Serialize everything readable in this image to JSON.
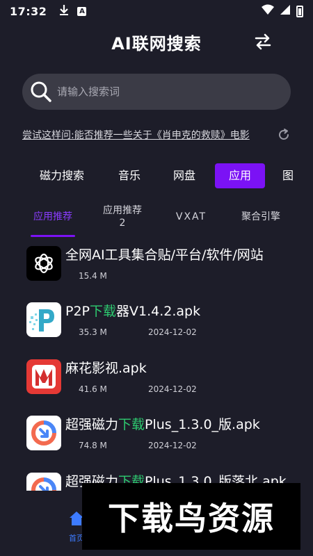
{
  "status_bar": {
    "time": "17:32",
    "icons": [
      "download-icon",
      "a-badge-icon",
      "wifi-icon",
      "signal-icon",
      "battery-icon"
    ]
  },
  "header": {
    "title": "AI联网搜索",
    "swap_icon": "swap-arrows-icon"
  },
  "search": {
    "placeholder": "请输入搜索词",
    "icon": "search-icon"
  },
  "suggestion": {
    "text": "尝试这样问:能否推荐一些关于《肖申克的救赎》电影",
    "refresh_icon": "refresh-icon"
  },
  "categories": {
    "items": [
      {
        "label": "磁力搜索"
      },
      {
        "label": "音乐"
      },
      {
        "label": "网盘"
      },
      {
        "label": "应用"
      },
      {
        "label": "图"
      }
    ],
    "active_index": 3,
    "active_color": "#7b12f5"
  },
  "sub_tabs": {
    "items": [
      {
        "label": "应用推荐"
      },
      {
        "label": "应用推荐\n2"
      },
      {
        "label": "VXAT"
      },
      {
        "label": "聚合引擎"
      }
    ],
    "active_index": 0
  },
  "results": [
    {
      "name": "全网AI工具集合贴/平台/软件/网站",
      "size": "15.4 M",
      "date": "",
      "icon": "openai-icon"
    },
    {
      "name_parts": [
        "P2P",
        "下载",
        "器V1.4.2.apk"
      ],
      "size": "35.3 M",
      "date": "2024-12-02",
      "icon": "p2p-icon"
    },
    {
      "name": "麻花影视.apk",
      "size": "41.6 M",
      "date": "2024-12-02",
      "icon": "mahua-icon"
    },
    {
      "name_parts": [
        "超强磁力",
        "下载",
        "Plus_1.3.0_版.apk"
      ],
      "size": "74.8 M",
      "date": "2024-12-02",
      "icon": "magnet-icon"
    },
    {
      "name_parts": [
        "超强磁力",
        "下载",
        "Plus_1.3.0_版落北.apk"
      ],
      "size": "",
      "date": "",
      "icon": "magnet-icon"
    }
  ],
  "bottom_nav": {
    "home_label": "首页",
    "home_color": "#3d7bff"
  },
  "watermark": {
    "text": "下载鸟资源"
  },
  "colors": {
    "background": "#1d1d29",
    "accent": "#7b12f5",
    "highlight": "#2ecc71"
  }
}
